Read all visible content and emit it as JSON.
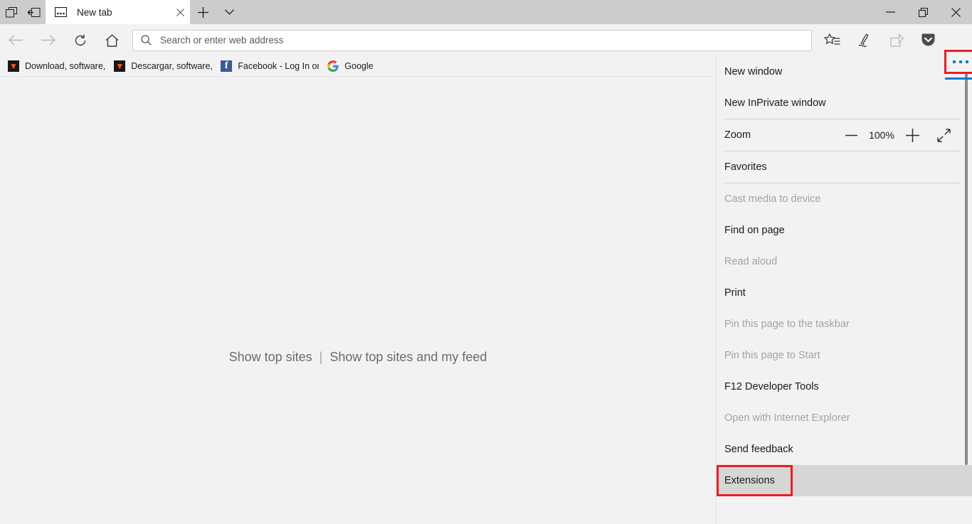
{
  "window": {
    "tab_aside_icon": "set-tabs-aside-icon",
    "tabs_aside_list_icon": "tabs-you-set-aside-icon",
    "tabs": [
      {
        "title": "New tab",
        "favicon": "new-tab-icon",
        "active": true,
        "close_icon": "close-icon"
      }
    ],
    "new_tab_button_label": "+",
    "tab_menu_icon": "chevron-down-icon",
    "controls": {
      "minimize": "minimize-icon",
      "restore": "restore-icon",
      "close": "close-icon"
    }
  },
  "toolbar": {
    "back_icon": "back-arrow-icon",
    "forward_icon": "forward-arrow-icon",
    "refresh_icon": "refresh-icon",
    "home_icon": "home-icon",
    "address": {
      "search_icon": "search-icon",
      "placeholder": "Search or enter web address",
      "value": ""
    },
    "right_icons": [
      {
        "name": "favorites-hub-icon",
        "label": "Favorites, reading list, books, history and downloads",
        "disabled": false
      },
      {
        "name": "make-a-web-note-icon",
        "label": "Make a Web Note",
        "disabled": false
      },
      {
        "name": "share-icon",
        "label": "Share this page",
        "disabled": true
      },
      {
        "name": "pocket-icon",
        "label": "Save to Pocket",
        "disabled": false
      }
    ],
    "settings_button": {
      "name": "settings-and-more-button",
      "label": "Settings and more",
      "dots": "ellipsis-icon",
      "highlighted": true,
      "highlight_color": "#ed1c24",
      "accent_color": "#0a78d4"
    }
  },
  "favorites_bar": {
    "items": [
      {
        "label": "Download, software, ",
        "icon": "softonic-favicon"
      },
      {
        "label": "Descargar, software, ",
        "icon": "softonic-favicon"
      },
      {
        "label": "Facebook - Log In or",
        "icon": "facebook-favicon"
      },
      {
        "label": "Google",
        "icon": "google-favicon"
      }
    ]
  },
  "page": {
    "link_show_top_sites": "Show top sites",
    "separator": "|",
    "link_show_top_sites_and_feed": "Show top sites and my feed"
  },
  "settings_menu": {
    "items": [
      {
        "label": "New window",
        "disabled": false,
        "type": "item",
        "name": "menu-item-new-window"
      },
      {
        "label": "New InPrivate window",
        "disabled": false,
        "type": "item",
        "name": "menu-item-new-inprivate-window"
      },
      {
        "type": "separator"
      },
      {
        "label": "Zoom",
        "type": "zoom",
        "name": "menu-item-zoom",
        "zoom_out_icon": "minus-icon",
        "value": "100%",
        "zoom_in_icon": "plus-icon",
        "fullscreen_icon": "fullscreen-icon"
      },
      {
        "type": "separator"
      },
      {
        "label": "Favorites",
        "disabled": false,
        "type": "item",
        "name": "menu-item-favorites"
      },
      {
        "type": "separator"
      },
      {
        "label": "Cast media to device",
        "disabled": true,
        "type": "item",
        "name": "menu-item-cast-media"
      },
      {
        "label": "Find on page",
        "disabled": false,
        "type": "item",
        "name": "menu-item-find-on-page"
      },
      {
        "label": "Read aloud",
        "disabled": true,
        "type": "item",
        "name": "menu-item-read-aloud"
      },
      {
        "label": "Print",
        "disabled": false,
        "type": "item",
        "name": "menu-item-print"
      },
      {
        "label": "Pin this page to the taskbar",
        "disabled": true,
        "type": "item",
        "name": "menu-item-pin-taskbar"
      },
      {
        "label": "Pin this page to Start",
        "disabled": true,
        "type": "item",
        "name": "menu-item-pin-start"
      },
      {
        "label": "F12 Developer Tools",
        "disabled": false,
        "type": "item",
        "name": "menu-item-f12-developer-tools"
      },
      {
        "label": "Open with Internet Explorer",
        "disabled": true,
        "type": "item",
        "name": "menu-item-open-with-ie"
      },
      {
        "label": "Send feedback",
        "disabled": false,
        "type": "item",
        "name": "menu-item-send-feedback"
      },
      {
        "label": "Extensions",
        "disabled": false,
        "type": "item",
        "name": "menu-item-extensions",
        "highlighted": true
      }
    ],
    "scrollbar": {
      "name": "menu-scrollbar"
    }
  }
}
